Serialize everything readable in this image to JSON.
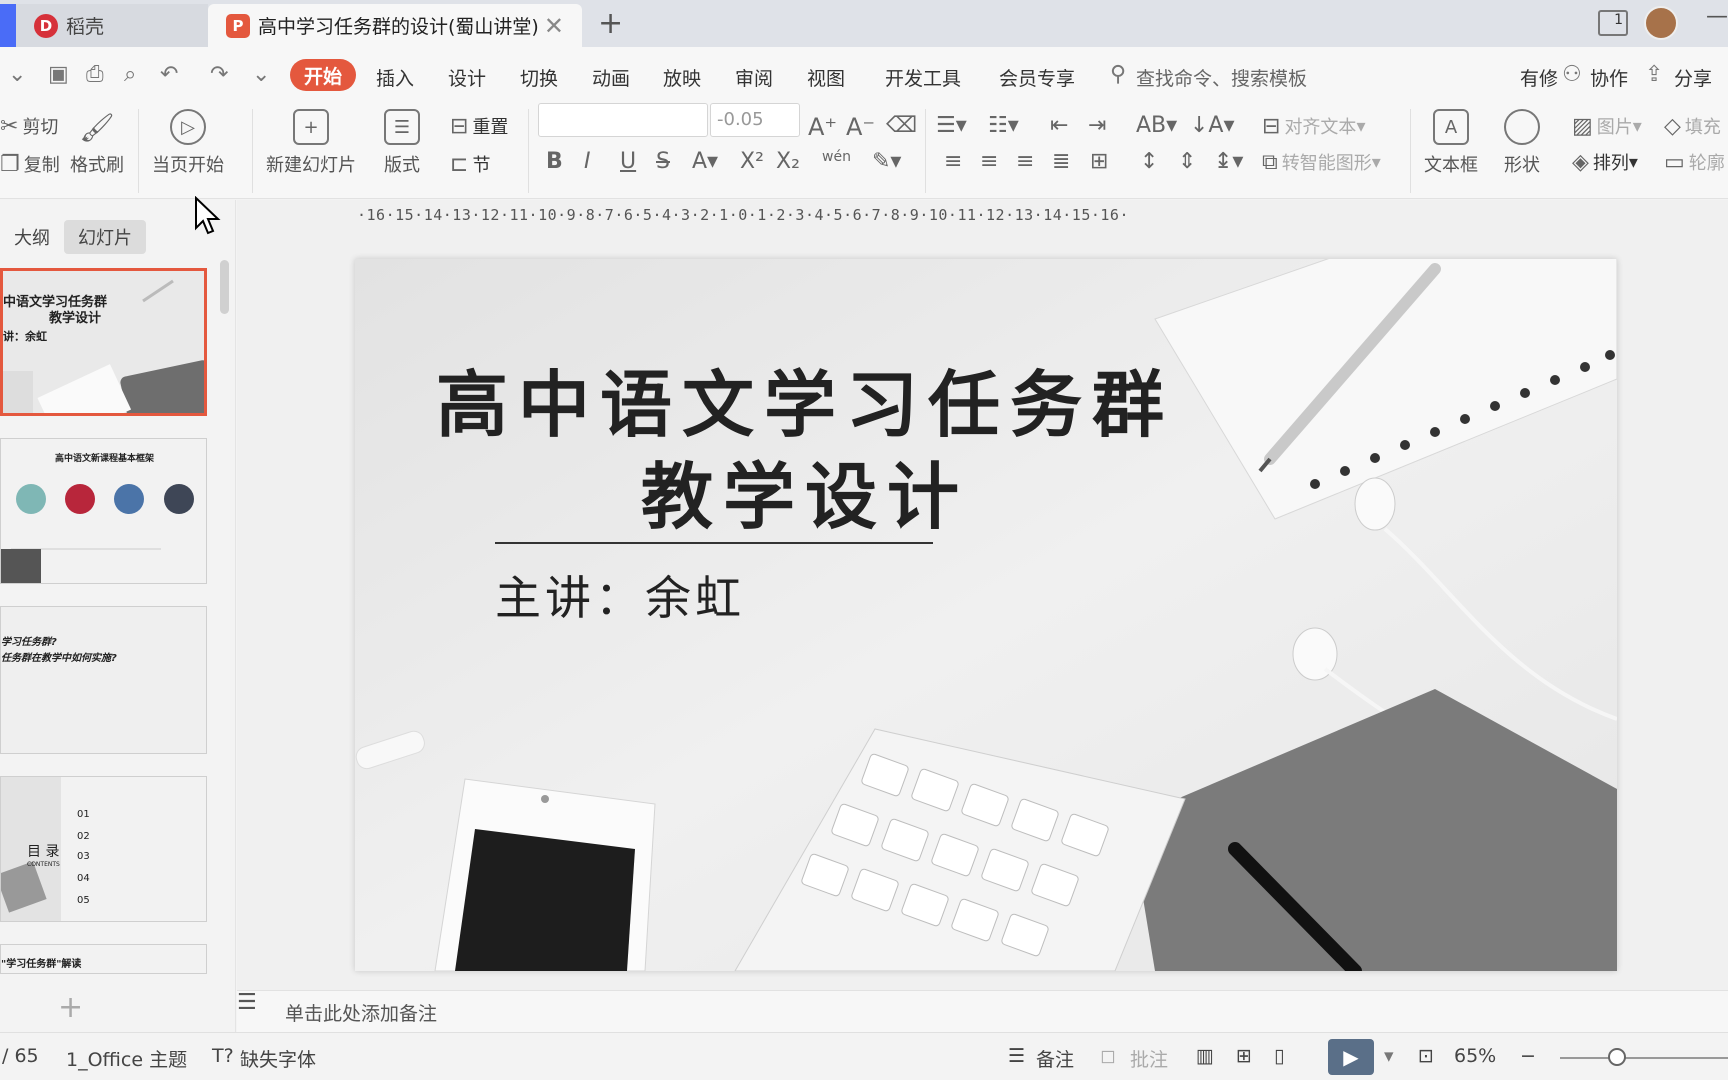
{
  "tabs": {
    "docer_label": "稻壳",
    "doc_label": "高中学习任务群的设计(蜀山讲堂)",
    "add_label": "+",
    "close_label": "✕",
    "page_indicator": "1"
  },
  "menu": {
    "items": [
      "开始",
      "插入",
      "设计",
      "切换",
      "动画",
      "放映",
      "审阅",
      "视图",
      "开发工具",
      "会员专享"
    ],
    "search_placeholder": "查找命令、搜索模板",
    "right": {
      "history": "有修",
      "collab": "协作",
      "share": "分享"
    }
  },
  "ribbon": {
    "cut": "剪切",
    "copy": "复制",
    "format_painter": "格式刷",
    "play_from_current": "当页开始",
    "new_slide": "新建幻灯片",
    "layout": "版式",
    "reset": "重置",
    "section": "节",
    "font_size_value": "-0.05",
    "align_text": "对齐文本",
    "smart_art": "转智能图形",
    "textbox": "文本框",
    "shape": "形状",
    "picture": "图片",
    "arrange": "排列",
    "fill": "填充",
    "outline": "轮廓",
    "pinyin": "wén"
  },
  "left_panel": {
    "tab_outline": "大纲",
    "tab_slides": "幻灯片",
    "thumb1": {
      "title": "中语文学习任务群",
      "subtitle": "教学设计",
      "speaker": "讲：余虹"
    },
    "thumb2": {
      "title": "高中语文新课程基本框架"
    },
    "thumb3": {
      "line1": "学习任务群?",
      "line2": "任务群在教学中如何实施?"
    },
    "thumb4": {
      "title": "目  录",
      "subtitle": "CONTENTS",
      "items": [
        "01",
        "02",
        "03",
        "04",
        "05"
      ]
    },
    "thumb5": {
      "title": "\"学习任务群\"解读"
    },
    "add": "+"
  },
  "slide": {
    "title_line1": "高中语文学习任务群",
    "title_line2": "教学设计",
    "subtitle": "主讲：余虹"
  },
  "ruler_text": "·16·15·14·13·12·11·10·9·8·7·6·5·4·3·2·1·0·1·2·3·4·5·6·7·8·9·10·11·12·13·14·15·16·",
  "notes_placeholder": "单击此处添加备注",
  "status": {
    "page": "/ 65",
    "theme": "1_Office 主题",
    "missing_font": "缺失字体",
    "notes": "备注",
    "comments": "批注",
    "zoom": "65%"
  }
}
